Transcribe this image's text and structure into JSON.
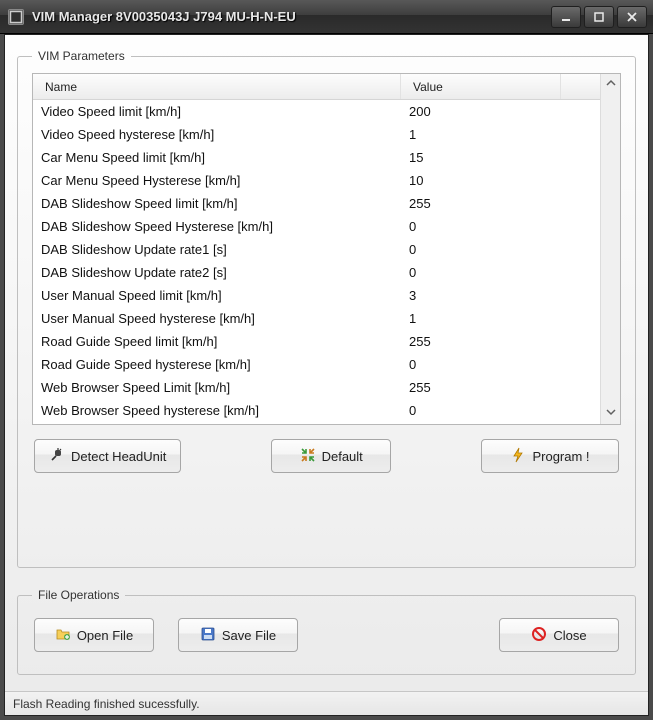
{
  "window": {
    "title": "VIM Manager 8V0035043J  J794  MU-H-N-EU"
  },
  "groups": {
    "params_legend": "VIM Parameters",
    "fileops_legend": "File Operations"
  },
  "list": {
    "header_name": "Name",
    "header_value": "Value",
    "rows": [
      {
        "name": "Video Speed limit [km/h]",
        "value": "200"
      },
      {
        "name": "Video Speed hysterese [km/h]",
        "value": "1"
      },
      {
        "name": "Car Menu Speed limit [km/h]",
        "value": "15"
      },
      {
        "name": "Car Menu Speed Hysterese [km/h]",
        "value": "10"
      },
      {
        "name": "DAB Slideshow Speed limit [km/h]",
        "value": "255"
      },
      {
        "name": "DAB Slideshow Speed Hysterese [km/h]",
        "value": "0"
      },
      {
        "name": "DAB Slideshow Update rate1 [s]",
        "value": "0"
      },
      {
        "name": "DAB Slideshow Update rate2 [s]",
        "value": "0"
      },
      {
        "name": "User Manual Speed limit [km/h]",
        "value": "3"
      },
      {
        "name": "User Manual Speed hysterese [km/h]",
        "value": "1"
      },
      {
        "name": "Road Guide Speed limit [km/h]",
        "value": "255"
      },
      {
        "name": "Road Guide Speed hysterese [km/h]",
        "value": "0"
      },
      {
        "name": "Web Browser Speed Limit [km/h]",
        "value": "255"
      },
      {
        "name": "Web Browser Speed hysterese [km/h]",
        "value": "0"
      }
    ]
  },
  "buttons": {
    "detect": "Detect HeadUnit",
    "default": "Default",
    "program": "Program !",
    "open": "Open File",
    "save": "Save File",
    "close": "Close"
  },
  "status": {
    "text": "Flash Reading finished sucessfully."
  }
}
